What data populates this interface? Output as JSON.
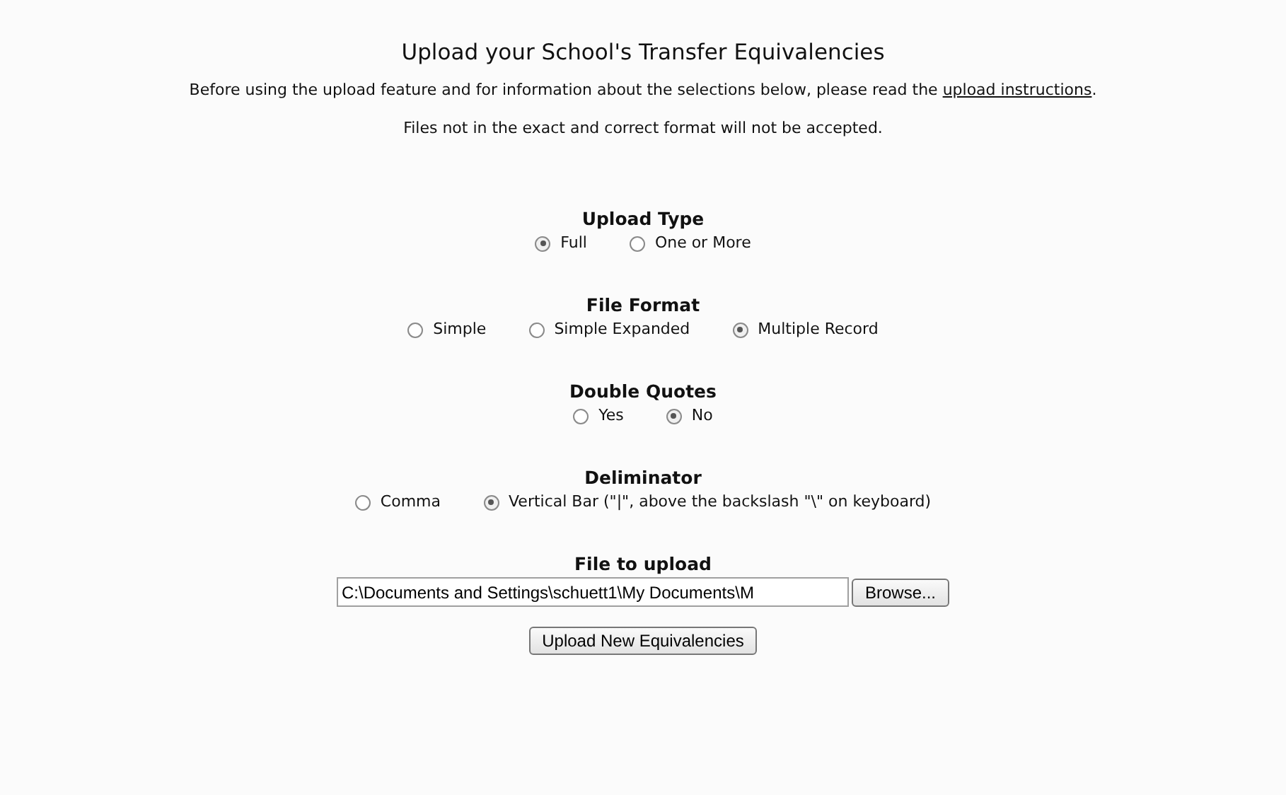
{
  "title": "Upload your School's Transfer Equivalencies",
  "intro": {
    "before": "Before using the upload feature and for information about the selections below, please read the ",
    "link": "upload instructions",
    "after": "."
  },
  "notice": "Files not in the exact and correct format will not be accepted.",
  "groups": [
    {
      "heading": "Upload Type",
      "options": [
        {
          "label": "Full",
          "selected": true
        },
        {
          "label": "One or More",
          "selected": false
        }
      ]
    },
    {
      "heading": "File Format",
      "options": [
        {
          "label": "Simple",
          "selected": false
        },
        {
          "label": "Simple Expanded",
          "selected": false
        },
        {
          "label": "Multiple Record",
          "selected": true
        }
      ]
    },
    {
      "heading": "Double Quotes",
      "options": [
        {
          "label": "Yes",
          "selected": false
        },
        {
          "label": "No",
          "selected": true
        }
      ]
    },
    {
      "heading": "Deliminator",
      "options": [
        {
          "label": "Comma",
          "selected": false
        },
        {
          "label": "Vertical Bar (\"|\", above the backslash \"\\\" on keyboard)",
          "selected": true
        }
      ]
    }
  ],
  "file": {
    "heading": "File to upload",
    "value": "C:\\Documents and Settings\\schuett1\\My Documents\\M",
    "browse": "Browse..."
  },
  "submit": "Upload New Equivalencies"
}
